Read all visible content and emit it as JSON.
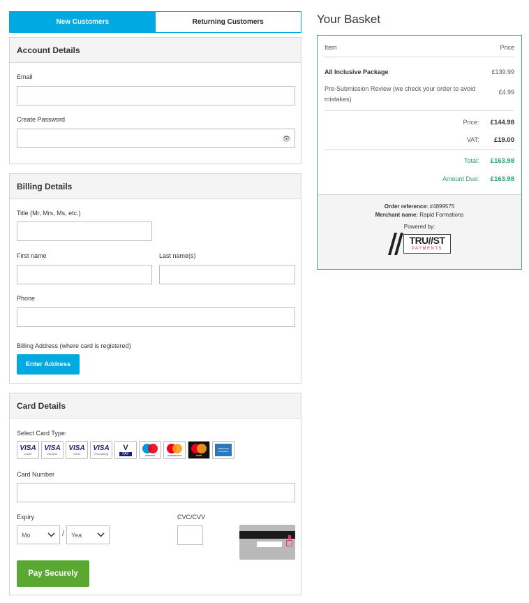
{
  "tabs": {
    "new_customers": "New Customers",
    "returning_customers": "Returning Customers"
  },
  "account": {
    "heading": "Account Details",
    "email_label": "Email",
    "email_value": "",
    "password_label": "Create Password",
    "password_value": ""
  },
  "billing": {
    "heading": "Billing Details",
    "title_label": "Title (Mr, Mrs, Ms, etc.)",
    "first_name_label": "First name",
    "last_name_label": "Last name(s)",
    "phone_label": "Phone",
    "address_label": "Billing Address (where card is registered)",
    "enter_address_button": "Enter Address"
  },
  "card": {
    "heading": "Card Details",
    "select_type_label": "Select Card Type:",
    "types": [
      {
        "name": "VISA",
        "sub": "Credit"
      },
      {
        "name": "VISA",
        "sub": "Electron"
      },
      {
        "name": "VISA",
        "sub": "Debit"
      },
      {
        "name": "VISA",
        "sub": "Purchasing"
      },
      {
        "name": "V",
        "sub": "PAY"
      },
      {
        "name": "maestro",
        "sub": "maestro"
      },
      {
        "name": "mastercard",
        "sub": "mastercard"
      },
      {
        "name": "mastercard",
        "sub": "debit"
      },
      {
        "name": "AMEX",
        "sub": "AMERICAN EXPRESS"
      }
    ],
    "number_label": "Card Number",
    "expiry_label": "Expiry",
    "month_value": "Mo",
    "year_value": "Yea",
    "expiry_sep": "/",
    "cvc_label": "CVC/CVV",
    "pay_button": "Pay Securely"
  },
  "basket": {
    "title": "Your Basket",
    "col_item": "Item",
    "col_price": "Price",
    "items": [
      {
        "name": "All Inclusive Package",
        "price": "£139.99"
      },
      {
        "name": "Pre-Submission Review (we check your order to avoid mistakes)",
        "price": "£4.99"
      }
    ],
    "price_label": "Price:",
    "price_value": "£144.98",
    "vat_label": "VAT:",
    "vat_value": "£19.00",
    "total_label": "Total:",
    "total_value": "£163.98",
    "due_label": "Amount Due:",
    "due_value": "£163.98",
    "order_ref_label": "Order reference:",
    "order_ref_value": "#4899575",
    "merchant_label": "Merchant name:",
    "merchant_value": "Rapid Formations",
    "powered_by": "Powered by:",
    "logo_text": "TRU//ST",
    "logo_sub": "PAYMENTS"
  },
  "colors": {
    "accent": "#00a9e0",
    "pay": "#5aa832",
    "total_green": "#2a9d6f",
    "basket_border": "#3aa68c"
  }
}
